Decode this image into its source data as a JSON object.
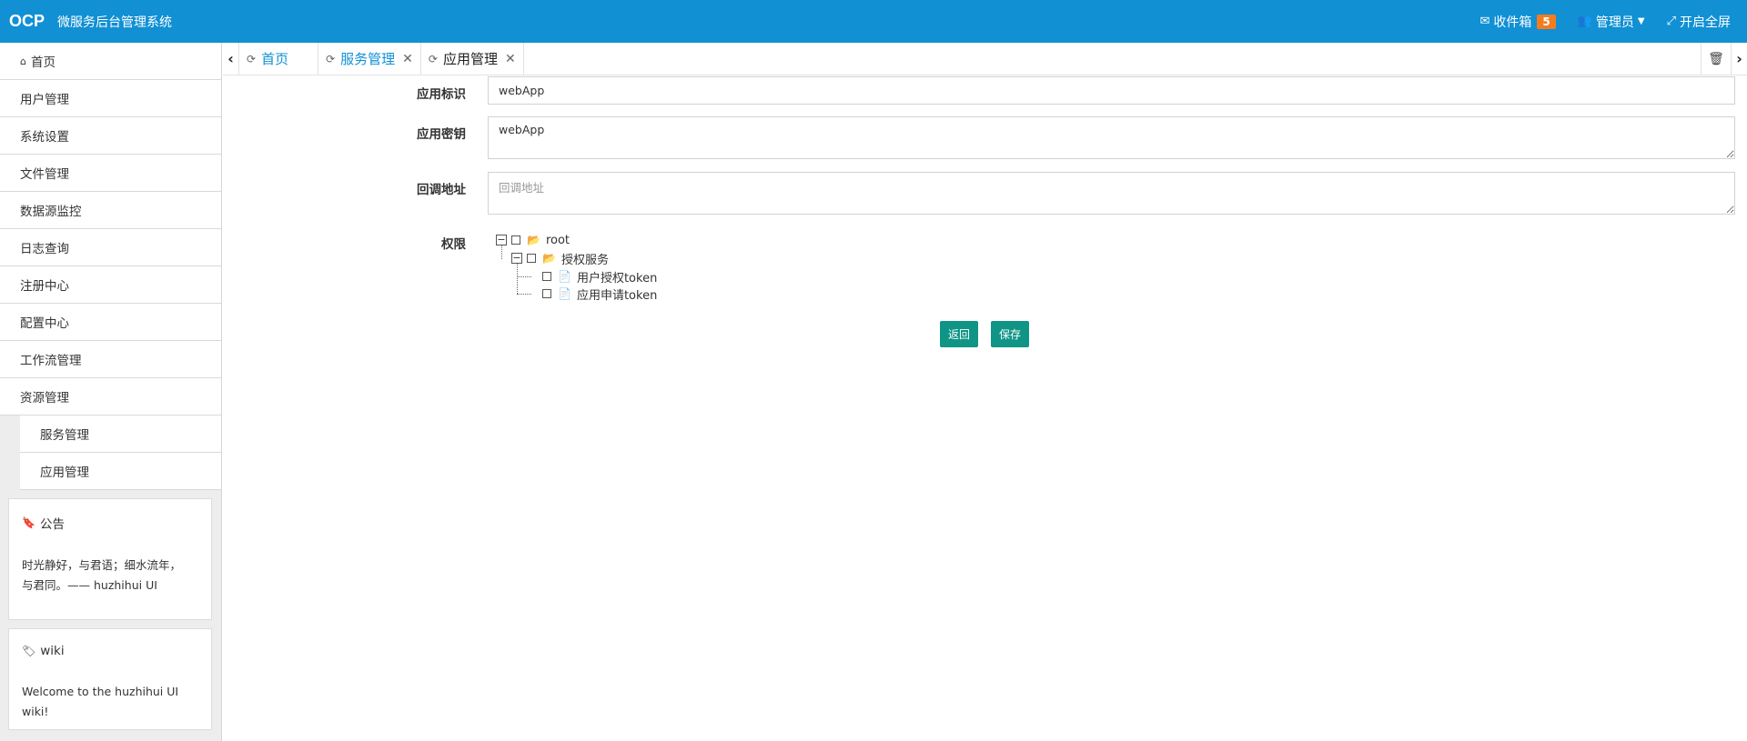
{
  "header": {
    "logo": "OCP",
    "system_name": "微服务后台管理系统",
    "inbox_label": "收件箱",
    "inbox_count": "5",
    "user_label": "管理员",
    "fullscreen_label": "开启全屏"
  },
  "sidebar": {
    "home_label": "首页",
    "items": [
      "用户管理",
      "系统设置",
      "文件管理",
      "数据源监控",
      "日志查询",
      "注册中心",
      "配置中心",
      "工作流管理",
      "资源管理"
    ],
    "sub_items": [
      "服务管理",
      "应用管理"
    ],
    "notice": {
      "title": "公告",
      "line1": "时光静好，与君语；细水流年，",
      "line2": "与君同。—— huzhihui UI"
    },
    "wiki": {
      "title": "wiki",
      "body": "Welcome to the huzhihui UI wiki!"
    }
  },
  "tabs": [
    {
      "label": "首页",
      "closable": false
    },
    {
      "label": "服务管理",
      "closable": true
    },
    {
      "label": "应用管理",
      "closable": true,
      "active": true
    }
  ],
  "form": {
    "app_id_label": "应用标识",
    "app_id_value": "webApp",
    "app_secret_label": "应用密钥",
    "app_secret_value": "webApp",
    "callback_label": "回调地址",
    "callback_placeholder": "回调地址",
    "perm_label": "权限",
    "tree": {
      "root": "root",
      "group": "授权服务",
      "leaves": [
        "用户授权token",
        "应用申请token"
      ]
    },
    "back_button": "返回",
    "save_button": "保存"
  }
}
